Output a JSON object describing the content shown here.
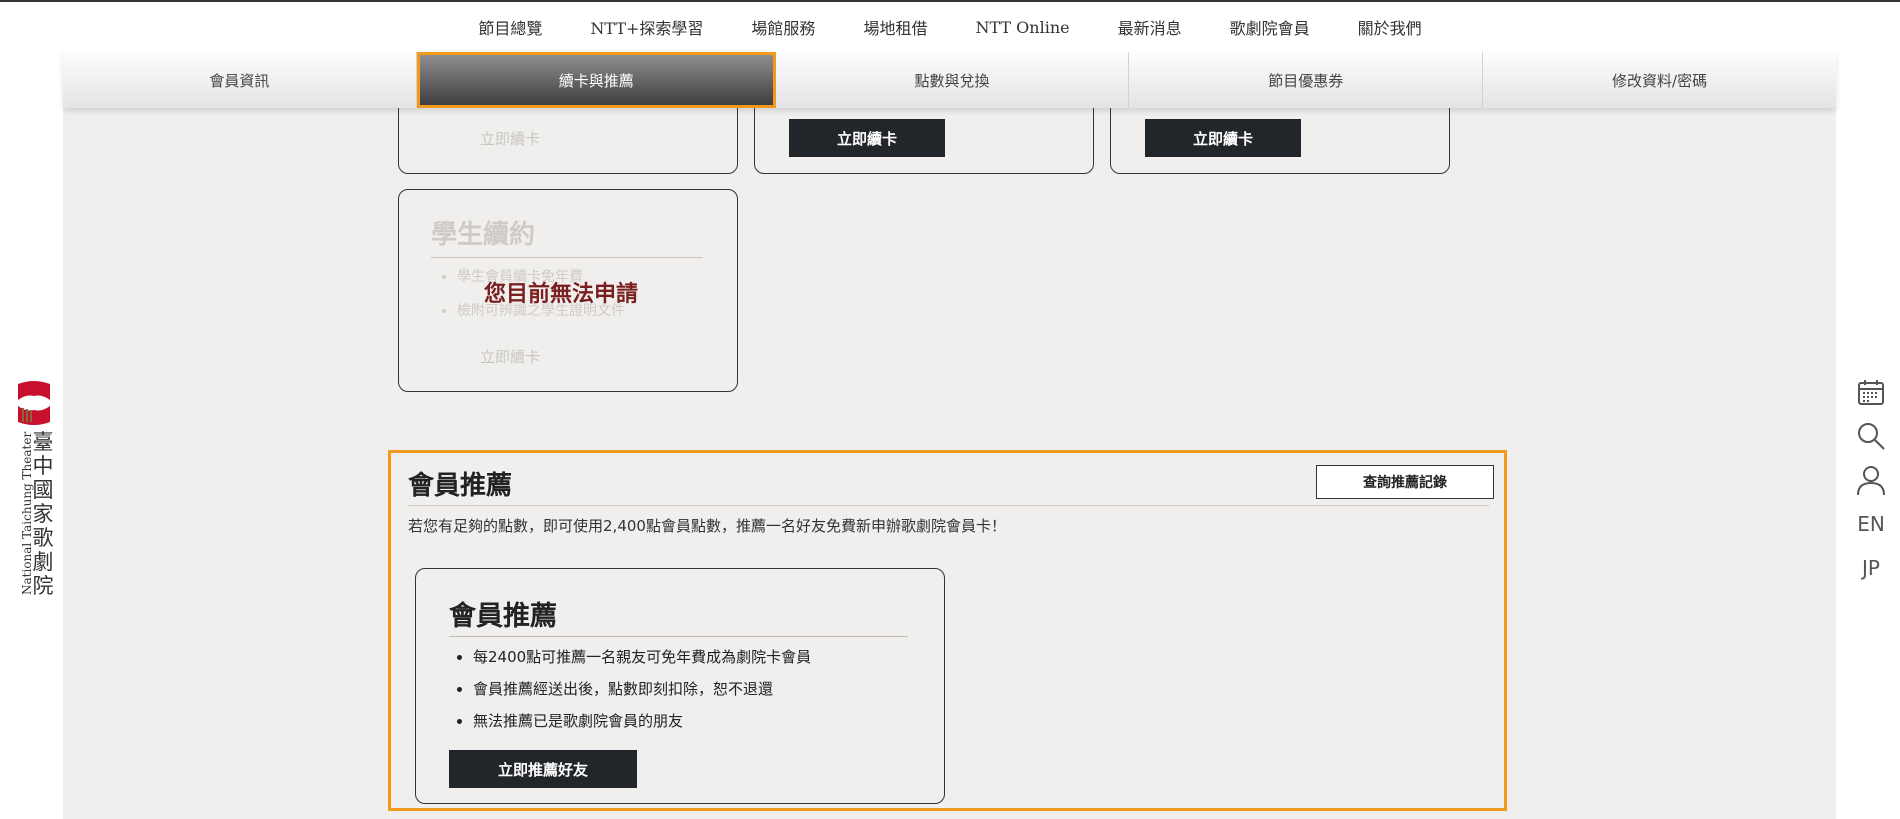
{
  "top_nav": {
    "items": [
      {
        "label": "節目總覽"
      },
      {
        "label": "NTT+探索學習"
      },
      {
        "label": "場館服務"
      },
      {
        "label": "場地租借"
      },
      {
        "label": "NTT Online"
      },
      {
        "label": "最新消息"
      },
      {
        "label": "歌劇院會員"
      },
      {
        "label": "關於我們"
      }
    ]
  },
  "sub_tabs": {
    "active_index": 1,
    "items": [
      {
        "label": "會員資訊"
      },
      {
        "label": "續卡與推薦"
      },
      {
        "label": "點數與兌換"
      },
      {
        "label": "節目優惠券"
      },
      {
        "label": "修改資料/密碼"
      }
    ]
  },
  "renew_cards": {
    "card1_button": "立即續卡",
    "card2_button": "立即續卡",
    "card3_button": "立即續卡"
  },
  "student_card": {
    "title": "學生續約",
    "items": [
      "學生會員續卡免年費",
      "檢附可辨識之學生證明文件"
    ],
    "overlay": "您目前無法申請",
    "button": "立即續卡"
  },
  "recommend": {
    "title": "會員推薦",
    "history_button": "查詢推薦記錄",
    "description": "若您有足夠的點數，即可使用2,400點會員點數，推薦一名好友免費新申辦歌劇院會員卡！",
    "card": {
      "title": "會員推薦",
      "items": [
        "每2400點可推薦一名親友可免年費成為劇院卡會員",
        "會員推薦經送出後，點數即刻扣除，恕不退還",
        "無法推薦已是歌劇院會員的朋友"
      ],
      "button": "立即推薦好友"
    }
  },
  "logo": {
    "name_en": "National Taichung Theater",
    "name_zh": "臺中國家歌劇院",
    "brand_color": "#c8102e"
  },
  "side_tools": {
    "items": [
      {
        "icon": "calendar-icon"
      },
      {
        "icon": "search-icon"
      },
      {
        "icon": "user-icon"
      },
      {
        "label": "EN"
      },
      {
        "label": "JP"
      }
    ]
  },
  "colors": {
    "highlight": "#f29a1d",
    "button_dark": "#22252a",
    "panel_bg": "#f0efed",
    "unavailable_text": "#7a1f1f"
  }
}
